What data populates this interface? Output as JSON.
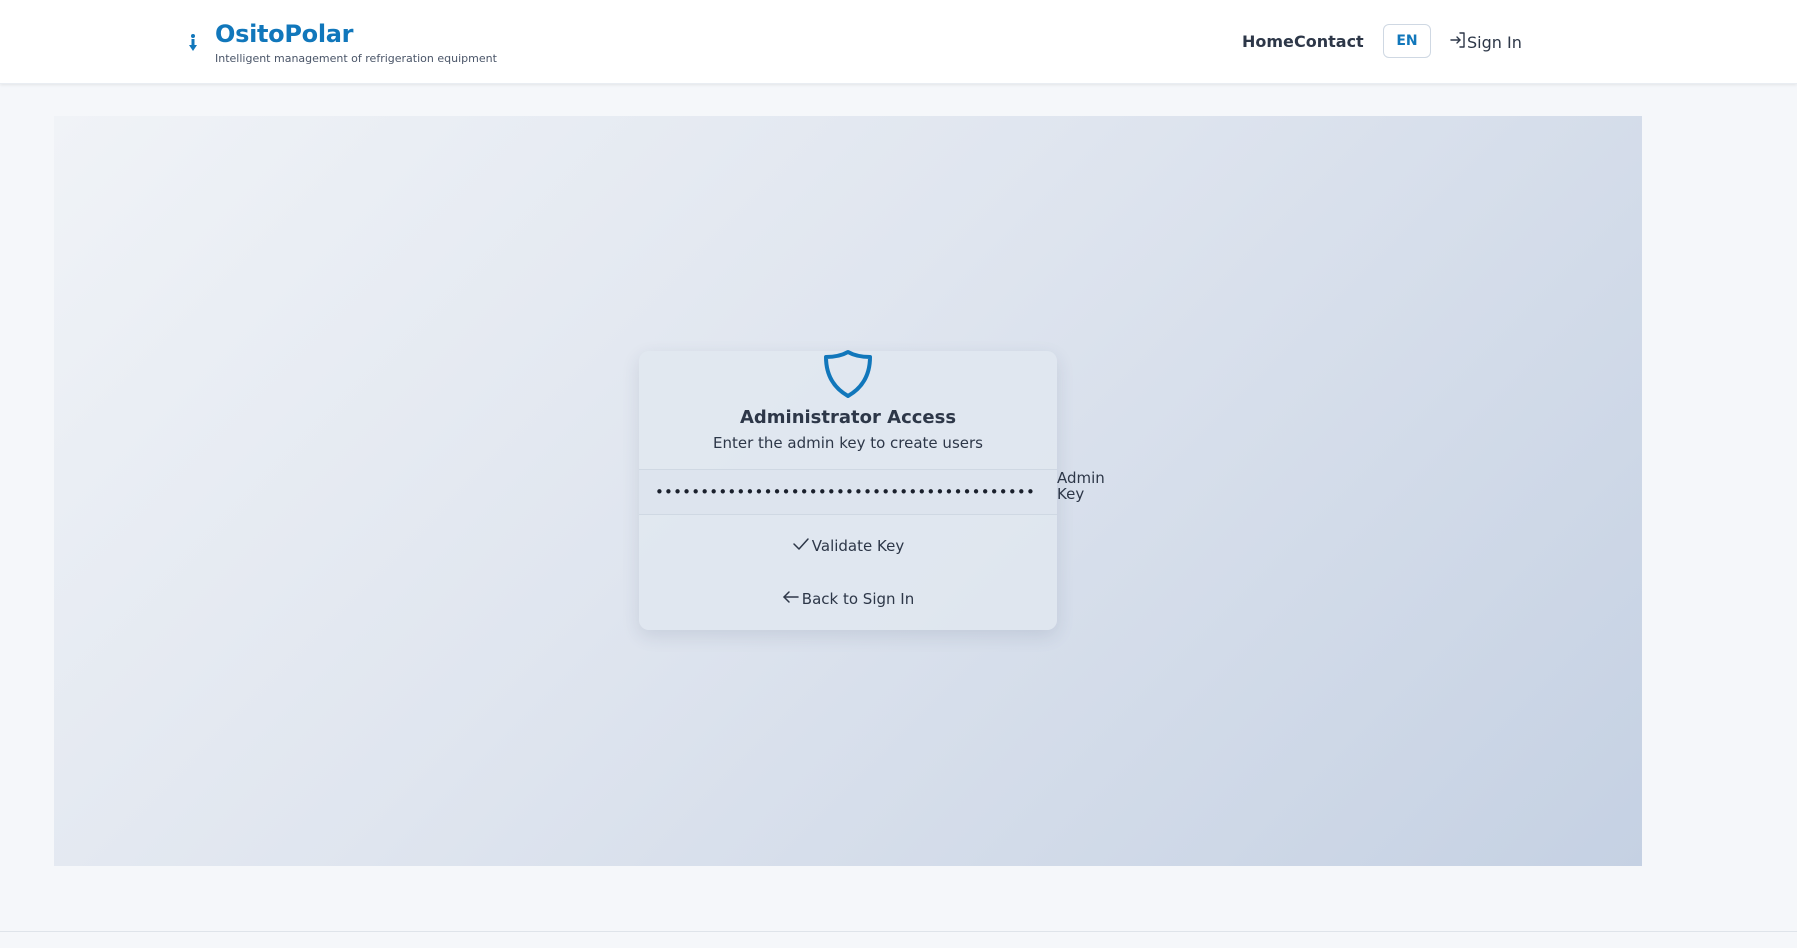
{
  "header": {
    "brand_title": "OsitoPolar",
    "brand_subtitle": "Intelligent management of refrigeration equipment",
    "brand_icon": "thermometer-icon",
    "nav": {
      "home": "Home",
      "contact": "Contact"
    },
    "language": "EN",
    "sign_in": "Sign In",
    "sign_in_icon": "login-icon"
  },
  "card": {
    "icon": "shield-icon",
    "title": "Administrator Access",
    "subtitle": "Enter the admin key to create users",
    "key_value": "••••••••••••••••••••••••••••••••••••••••••",
    "key_label": "Admin Key",
    "validate_label": "Validate Key",
    "validate_icon": "check-icon",
    "back_label": "Back to Sign In",
    "back_icon": "arrow-left-icon"
  },
  "colors": {
    "brand": "#1177bb",
    "text": "#2d3748",
    "page_bg": "#f5f7fa"
  }
}
